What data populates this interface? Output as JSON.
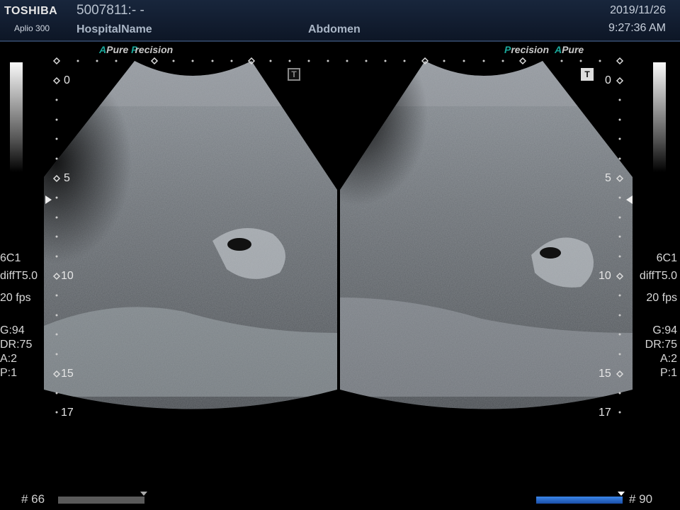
{
  "header": {
    "brand": "TOSHIBA",
    "model": "Aplio 300",
    "patient_id": "5007811:- -",
    "hospital": "HospitalName",
    "exam": "Abdomen",
    "date": "2019/11/26",
    "time": "9:27:36 AM"
  },
  "logos": {
    "left": {
      "a": "A",
      "pure": "Pure",
      "p": "P",
      "precision": "recision"
    },
    "right": {
      "p": "P",
      "precision": "recision",
      "a": "A",
      "pure": "Pure"
    }
  },
  "depth_scale": {
    "mark0": "0",
    "mark5": "5",
    "mark10": "10",
    "mark15": "15",
    "mark17": "17"
  },
  "params": {
    "probe": "6C1",
    "mode": "diffT5.0",
    "fps": "20 fps",
    "gain": "G:94",
    "dr": "DR:75",
    "a": "A:2",
    "p": "P:1"
  },
  "frames": {
    "left_label": "# 66",
    "right_label": "# 90",
    "left_progress": 1.0,
    "right_progress": 1.0
  },
  "icons": {
    "t": "T"
  },
  "colors": {
    "header_bg": "#18263c",
    "accent": "#1aa79a",
    "progress": "#2d6fd0"
  }
}
